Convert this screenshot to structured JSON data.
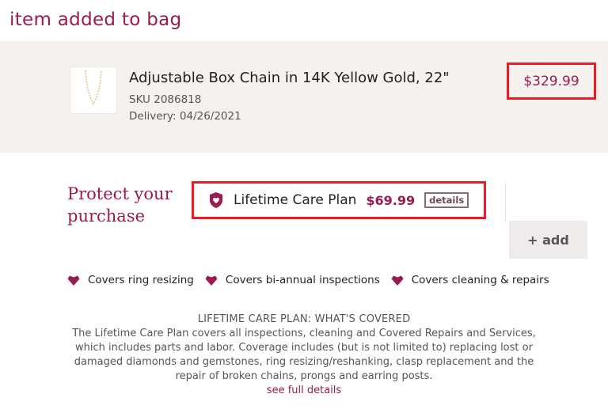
{
  "header": {
    "title": "item added to bag"
  },
  "item": {
    "name": "Adjustable Box Chain in 14K Yellow Gold, 22\"",
    "sku": "SKU 2086818",
    "delivery": "Delivery: 04/26/2021",
    "price": "$329.99",
    "thumbnail_icon": "gold-chain-icon"
  },
  "protect": {
    "title": "Protect your purchase",
    "plan_icon": "shield-heart-icon",
    "plan_name": "Lifetime Care Plan",
    "plan_price": "$69.99",
    "details_label": "details",
    "add_label": "+ add"
  },
  "benefits": [
    {
      "icon": "heart-icon",
      "label": "Covers ring resizing"
    },
    {
      "icon": "heart-icon",
      "label": "Covers bi-annual inspections"
    },
    {
      "icon": "heart-icon",
      "label": "Covers cleaning & repairs"
    }
  ],
  "coverage": {
    "title": "LIFETIME CARE PLAN: WHAT'S COVERED",
    "body": "The Lifetime Care Plan covers all inspections, cleaning and Covered Repairs and Services, which includes parts and labor. Coverage includes (but is not limited to) replacing lost or damaged diamonds and gemstones, ring resizing/reshanking, clasp replacement and the repair of broken chains, prongs and earring posts.",
    "see_full_label": "see full details"
  },
  "colors": {
    "brand": "#9a1b50",
    "highlight": "#ec1c24",
    "panel": "#f4f1ef"
  }
}
